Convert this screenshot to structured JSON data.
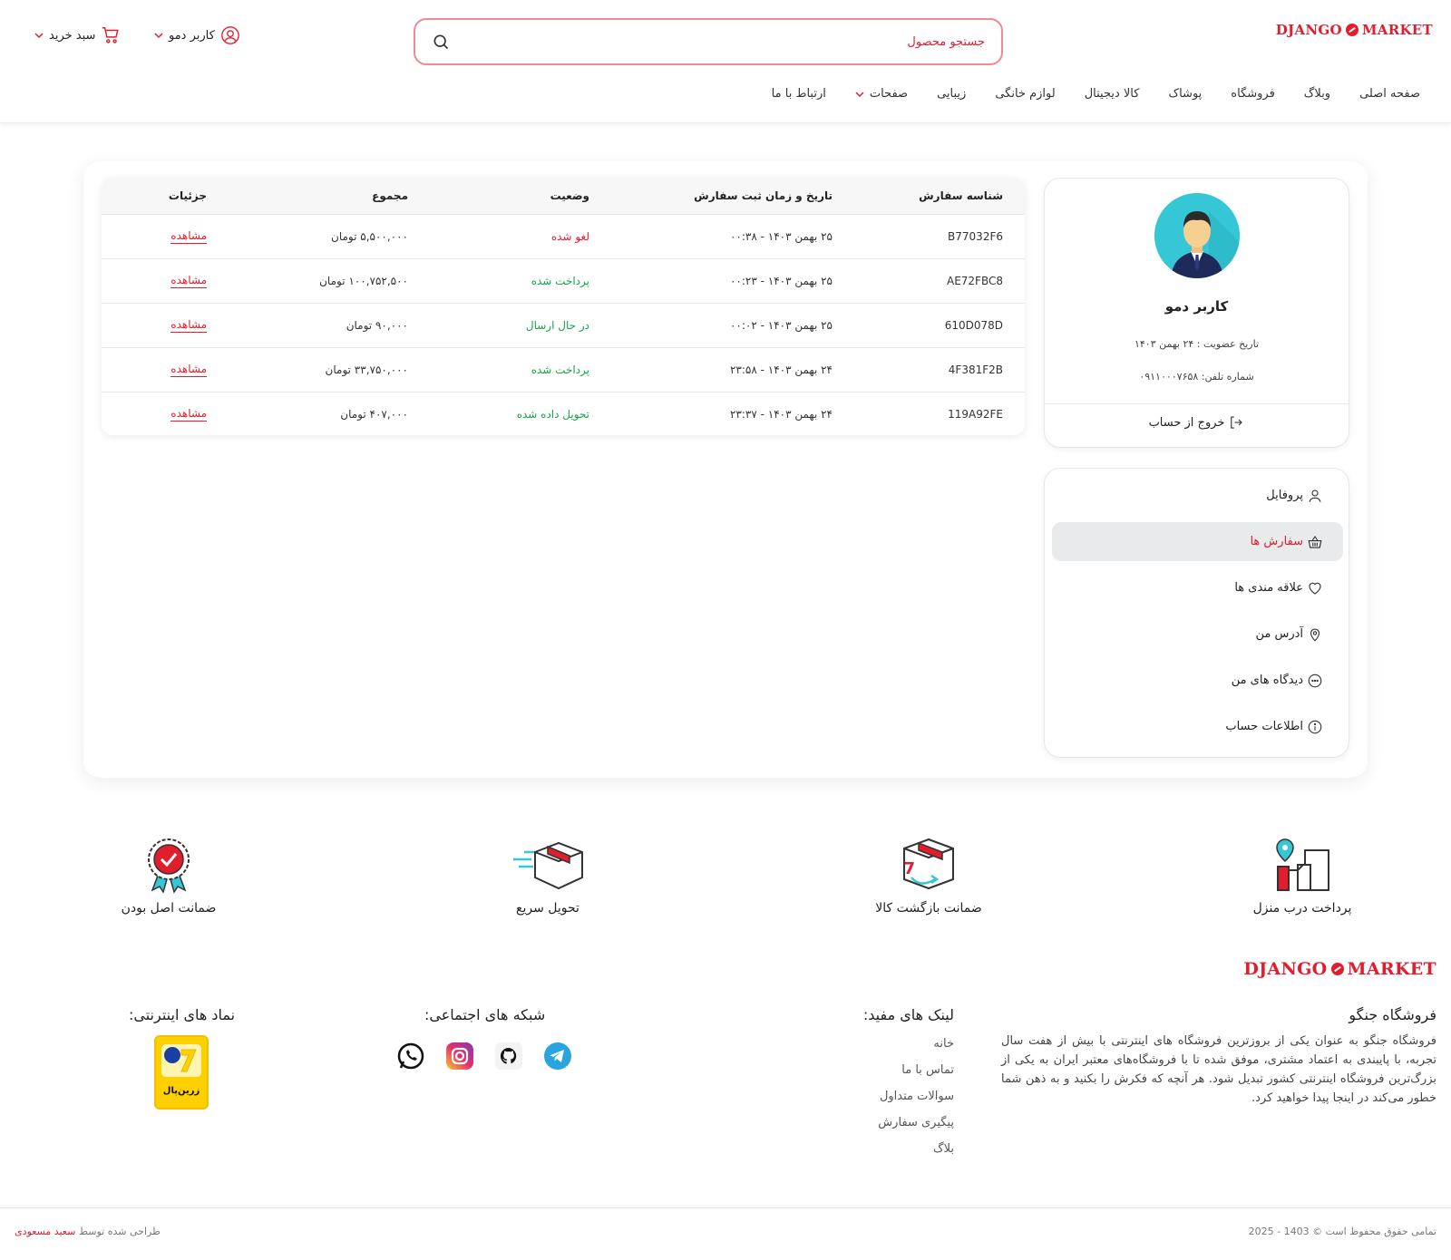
{
  "header": {
    "logo_left": "DJANGO",
    "logo_right": "MARKET",
    "search_placeholder": "جستجو محصول",
    "user_label": "کاربر دمو",
    "cart_label": "سبد خرید",
    "nav": [
      "صفحه اصلی",
      "وبلاگ",
      "فروشگاه",
      "پوشاک",
      "کالا دیجیتال",
      "لوازم خانگی",
      "زیبایی",
      "صفحات",
      "ارتباط با ما"
    ]
  },
  "profile": {
    "name": "کاربر دمو",
    "member_since": "تاریخ عضویت : ۲۴ بهمن ۱۴۰۳",
    "phone": "شماره تلفن: ۰۹۱۱۰۰۰۷۶۵۸",
    "logout": "خروج از حساب"
  },
  "menu": [
    {
      "label": "پروفایل",
      "icon": "user-icon",
      "active": false
    },
    {
      "label": "سفارش ها",
      "icon": "basket-icon",
      "active": true
    },
    {
      "label": "علاقه مندی ها",
      "icon": "heart-icon",
      "active": false
    },
    {
      "label": "آدرس من",
      "icon": "location-icon",
      "active": false
    },
    {
      "label": "دیدگاه های من",
      "icon": "comment-icon",
      "active": false
    },
    {
      "label": "اطلاعات حساب",
      "icon": "info-icon",
      "active": false
    }
  ],
  "orders": {
    "headers": {
      "id": "شناسه سفارش",
      "date": "تاریخ و زمان ثبت سفارش",
      "status": "وضعیت",
      "total": "مجموع",
      "details": "جزئیات"
    },
    "rows": [
      {
        "id": "B77032F6",
        "date": "۲۵ بهمن ۱۴۰۳ - ۰۰:۳۸",
        "status": "لغو شده",
        "status_color": "#e11d2e",
        "total": "۵,۵۰۰,۰۰۰ تومان",
        "details": "مشاهده"
      },
      {
        "id": "AE72FBC8",
        "date": "۲۵ بهمن ۱۴۰۳ - ۰۰:۲۳",
        "status": "پرداخت شده",
        "status_color": "#16a34a",
        "total": "۱۰۰,۷۵۲,۵۰۰ تومان",
        "details": "مشاهده"
      },
      {
        "id": "610D078D",
        "date": "۲۵ بهمن ۱۴۰۳ - ۰۰:۰۲",
        "status": "در حال ارسال",
        "status_color": "#16a34a",
        "total": "۹۰,۰۰۰ تومان",
        "details": "مشاهده"
      },
      {
        "id": "4F381F2B",
        "date": "۲۴ بهمن ۱۴۰۳ - ۲۳:۵۸",
        "status": "پرداخت شده",
        "status_color": "#16a34a",
        "total": "۳۳,۷۵۰,۰۰۰ تومان",
        "details": "مشاهده"
      },
      {
        "id": "119A92FE",
        "date": "۲۴ بهمن ۱۴۰۳ - ۲۳:۳۷",
        "status": "تحویل داده شده",
        "status_color": "#16a34a",
        "total": "۴۰۷,۰۰۰ تومان",
        "details": "مشاهده"
      }
    ]
  },
  "features": [
    "پرداخت درب منزل",
    "ضمانت بازگشت کالا",
    "تحویل سریع",
    "ضمانت اصل بودن"
  ],
  "footer": {
    "about_title": "فروشگاه جنگو",
    "about_text": "فروشگاه جنگو به عنوان یکی از بروزترین فروشگاه های اینترنتی با بیش از هفت سال تجربه، با پایبندی به اعتماد مشتری، موفق شده تا با فروشگاه‌های معتبر ایران به یکی از بزرگ‌ترین فروشگاه اینترنتی کشور تبدیل شود. هر آنچه که فکرش را بکنید و به ذهن شما خطور می‌کند در اینجا پیدا خواهید کرد.",
    "links_title": "لینک های مفید:",
    "links": [
      "خانه",
      "تماس با ما",
      "سوالات متداول",
      "پیگیری سفارش",
      "بلاگ"
    ],
    "social_title": "شبکه های اجتماعی:",
    "social_icons": [
      "telegram-icon",
      "github-icon",
      "instagram-icon",
      "whatsapp-icon"
    ],
    "trust_title": "نماد های اینترنتی:",
    "trust_badge_text": "زرین‌پال",
    "copyright": "تمامی حقوق محفوظ است © 1403 - 2025",
    "credit_prefix": "طراحی شده توسط",
    "credit_name": "سعید مسعودی"
  }
}
